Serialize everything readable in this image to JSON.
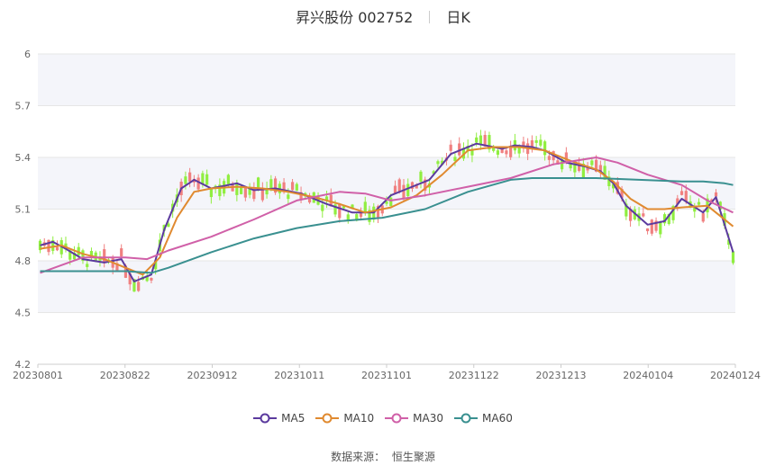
{
  "header": {
    "stock": "昇兴股份 002752",
    "period": "日K"
  },
  "source": {
    "label": "数据来源：",
    "provider": "恒生聚源"
  },
  "chart_data": {
    "type": "candlestick",
    "yaxis": {
      "min": 4.2,
      "max": 6.0,
      "ticks": [
        "4.2",
        "4.5",
        "4.8",
        "5.1",
        "5.4",
        "5.7",
        "6"
      ]
    },
    "xaxis": {
      "ticks": [
        "20230801",
        "20230822",
        "20230912",
        "20231011",
        "20231101",
        "20231122",
        "20231213",
        "20240104",
        "20240124"
      ]
    },
    "colors": {
      "up": "#f08080",
      "down": "#90ee40",
      "MA5": "#5b3a9e",
      "MA10": "#e08a30",
      "MA30": "#d060a8",
      "MA60": "#3a9090"
    },
    "legend": [
      "MA5",
      "MA10",
      "MA30",
      "MA60"
    ],
    "series": [
      {
        "name": "MA5",
        "x": [
          0,
          3,
          6,
          10,
          15,
          19,
          22,
          26,
          29,
          33,
          36,
          40,
          46,
          50,
          55,
          61,
          67,
          73,
          78,
          82,
          86,
          91,
          96,
          102,
          108,
          111,
          115,
          118,
          123,
          127,
          131,
          134,
          137,
          142,
          146,
          150,
          155,
          158,
          162
        ],
        "y": [
          4.89,
          4.91,
          4.87,
          4.81,
          4.79,
          4.81,
          4.68,
          4.72,
          4.98,
          5.22,
          5.27,
          5.22,
          5.25,
          5.21,
          5.22,
          5.19,
          5.13,
          5.08,
          5.08,
          5.18,
          5.22,
          5.27,
          5.42,
          5.48,
          5.45,
          5.47,
          5.46,
          5.44,
          5.37,
          5.35,
          5.32,
          5.25,
          5.12,
          5.01,
          5.03,
          5.16,
          5.08,
          5.17,
          4.85
        ]
      },
      {
        "name": "MA10",
        "x": [
          0,
          5,
          10,
          15,
          20,
          24,
          28,
          32,
          36,
          40,
          46,
          52,
          58,
          64,
          70,
          76,
          82,
          88,
          94,
          100,
          106,
          112,
          118,
          124,
          130,
          134,
          138,
          142,
          146,
          150,
          156,
          162
        ],
        "y": [
          4.87,
          4.89,
          4.84,
          4.81,
          4.76,
          4.72,
          4.82,
          5.05,
          5.2,
          5.22,
          5.23,
          5.22,
          5.2,
          5.17,
          5.13,
          5.08,
          5.11,
          5.18,
          5.3,
          5.44,
          5.46,
          5.46,
          5.44,
          5.38,
          5.33,
          5.26,
          5.16,
          5.1,
          5.1,
          5.11,
          5.12,
          5.0
        ]
      },
      {
        "name": "MA30",
        "x": [
          0,
          10,
          20,
          25,
          30,
          40,
          50,
          60,
          70,
          76,
          82,
          90,
          100,
          110,
          120,
          130,
          135,
          142,
          150,
          156,
          162
        ],
        "y": [
          4.73,
          4.82,
          4.82,
          4.81,
          4.86,
          4.94,
          5.04,
          5.15,
          5.2,
          5.19,
          5.15,
          5.18,
          5.23,
          5.28,
          5.36,
          5.4,
          5.37,
          5.3,
          5.24,
          5.15,
          5.08
        ]
      },
      {
        "name": "MA60",
        "x": [
          0,
          10,
          20,
          26,
          30,
          40,
          50,
          60,
          70,
          80,
          90,
          100,
          110,
          115,
          120,
          130,
          140,
          150,
          155,
          160,
          162
        ],
        "y": [
          4.74,
          4.74,
          4.74,
          4.73,
          4.76,
          4.85,
          4.93,
          4.99,
          5.03,
          5.05,
          5.1,
          5.2,
          5.27,
          5.28,
          5.28,
          5.28,
          5.27,
          5.26,
          5.26,
          5.25,
          5.24
        ]
      }
    ]
  }
}
